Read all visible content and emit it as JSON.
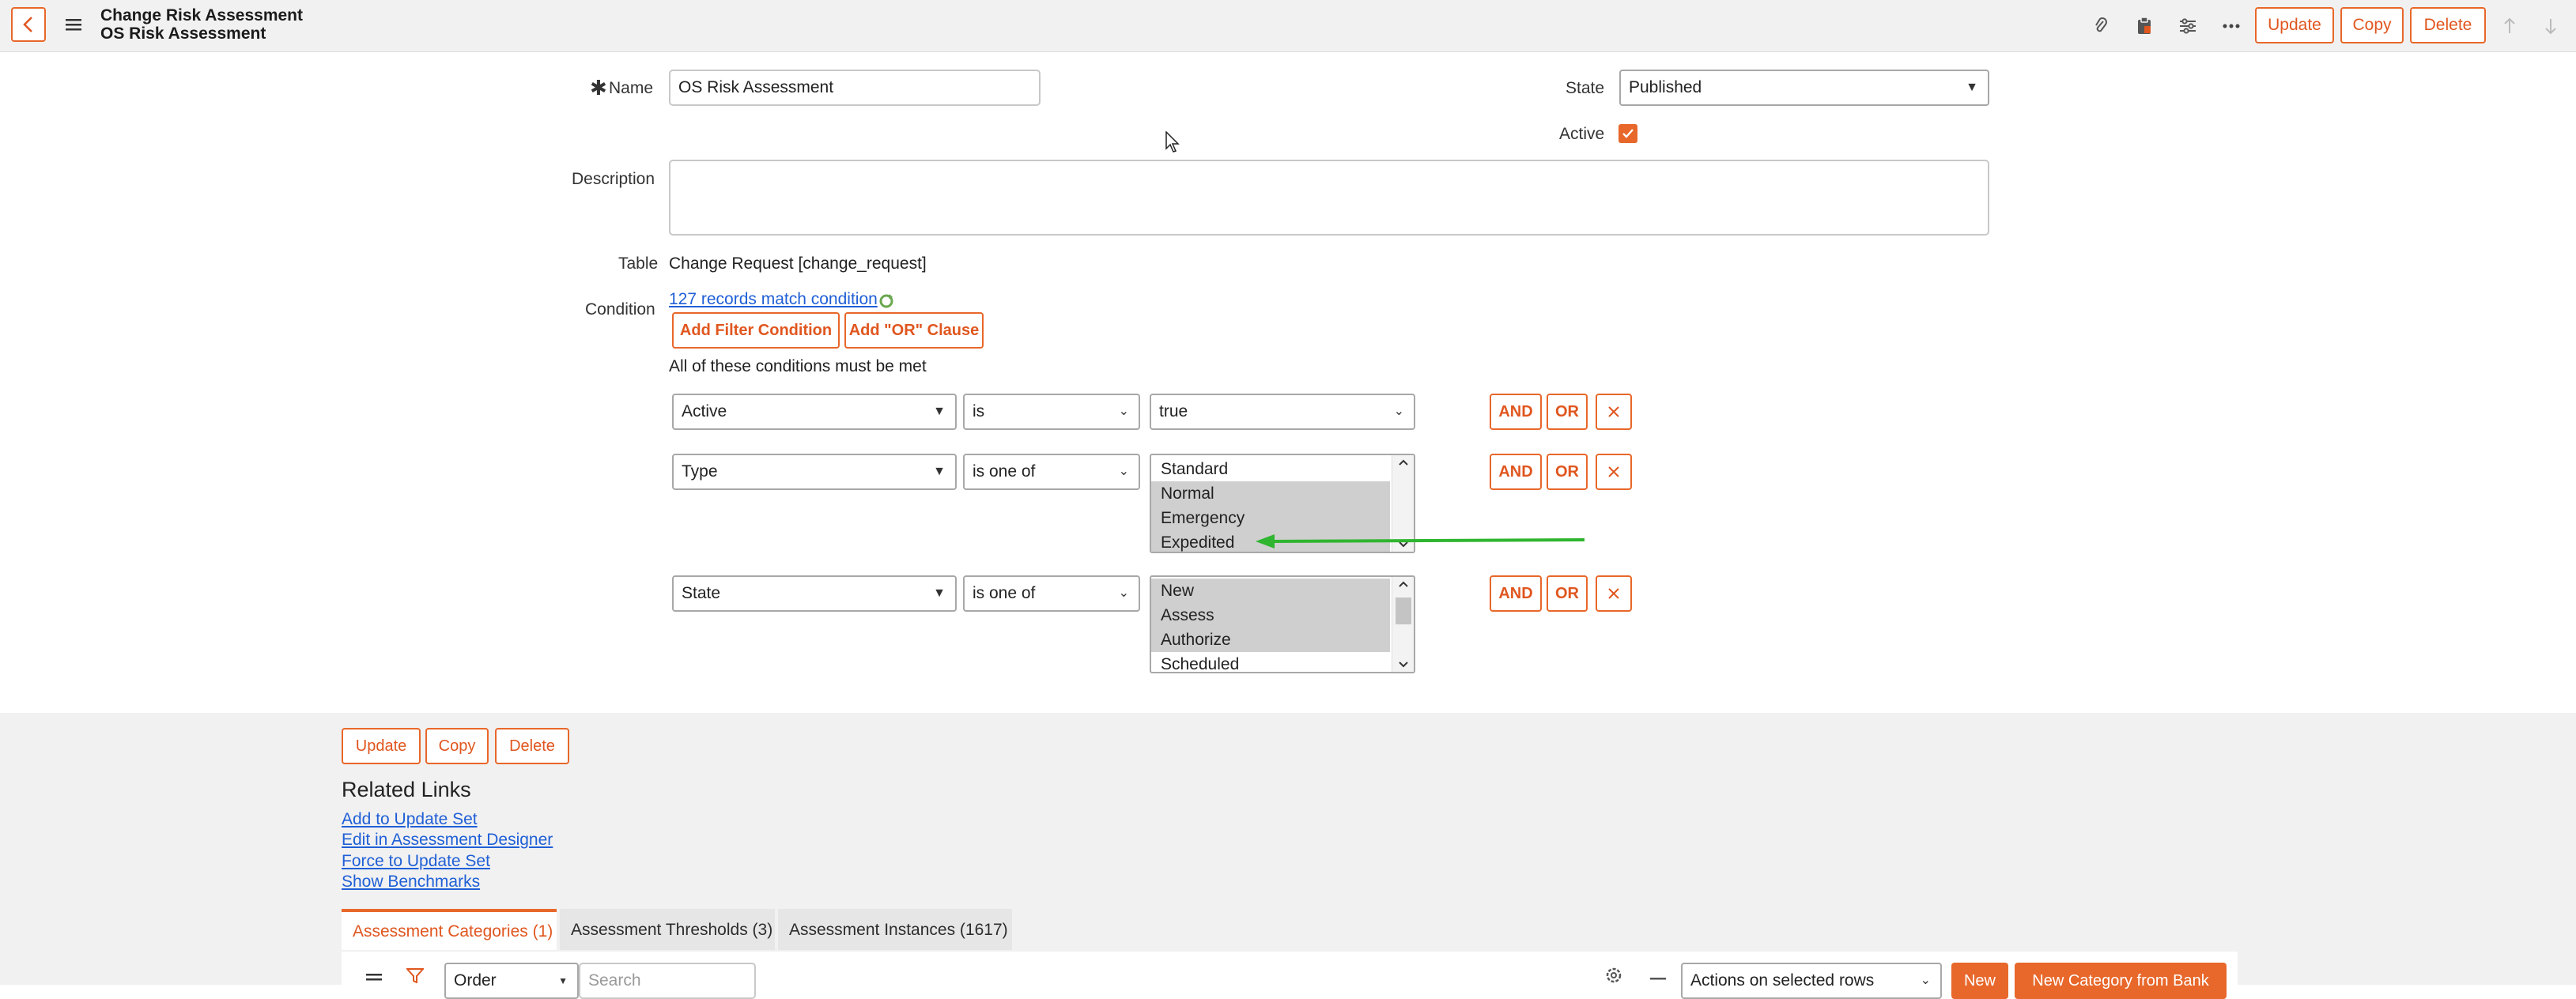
{
  "header": {
    "title_line1": "Change Risk Assessment",
    "title_line2": "OS Risk Assessment",
    "buttons": {
      "update": "Update",
      "copy": "Copy",
      "delete": "Delete"
    }
  },
  "form": {
    "name_label": "Name",
    "name_value": "OS Risk Assessment",
    "state_label": "State",
    "state_value": "Published",
    "active_label": "Active",
    "active_checked": true,
    "description_label": "Description",
    "description_value": "",
    "table_label": "Table",
    "table_value": "Change Request [change_request]",
    "condition_label": "Condition",
    "records_match_link": "127 records match condition",
    "add_filter_condition": "Add Filter Condition",
    "add_or_clause": "Add \"OR\" Clause",
    "all_conditions_text": "All of these conditions must be met",
    "conditions": [
      {
        "field": "Active",
        "operator": "is",
        "value": "true"
      },
      {
        "field": "Type",
        "operator": "is one of",
        "options": [
          "Standard",
          "Normal",
          "Emergency",
          "Expedited"
        ],
        "selected": [
          "Normal",
          "Emergency",
          "Expedited"
        ]
      },
      {
        "field": "State",
        "operator": "is one of",
        "options": [
          "New",
          "Assess",
          "Authorize",
          "Scheduled"
        ],
        "selected": [
          "New",
          "Assess",
          "Authorize"
        ]
      }
    ],
    "and_label": "AND",
    "or_label": "OR"
  },
  "bottom_buttons": {
    "update": "Update",
    "copy": "Copy",
    "delete": "Delete"
  },
  "related_links": {
    "heading": "Related Links",
    "links": [
      "Add to Update Set",
      "Edit in Assessment Designer",
      "Force to Update Set",
      "Show Benchmarks"
    ]
  },
  "tabs": [
    {
      "label": "Assessment Categories (1)",
      "active": true
    },
    {
      "label": "Assessment Thresholds (3)",
      "active": false
    },
    {
      "label": "Assessment Instances (1617)",
      "active": false
    }
  ],
  "list_toolbar": {
    "order_select": "Order",
    "search_placeholder": "Search",
    "actions_select": "Actions on selected rows",
    "new_button": "New",
    "new_from_bank_button": "New Category from Bank"
  },
  "colors": {
    "accent": "#e8672a",
    "link": "#1f5fd6",
    "annotation_arrow": "#2fb52f"
  }
}
